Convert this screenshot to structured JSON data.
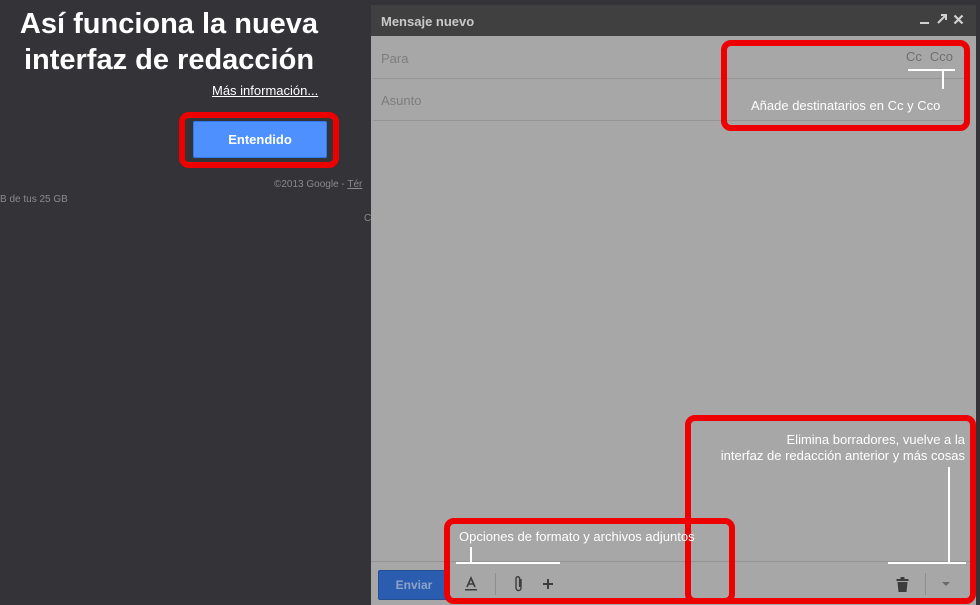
{
  "background": {
    "footer_text": "©2013 Google - ",
    "footer_link": "Tér",
    "storage_text": "B de tus 25 GB",
    "partial_char": "C"
  },
  "tour": {
    "title": "Así funciona la nueva interfaz de redacción",
    "more_info_link": "Más información...",
    "got_it_button": "Entendido"
  },
  "compose": {
    "window_title": "Mensaje nuevo",
    "header_icons": [
      "minimize-icon",
      "pop-out-icon",
      "close-icon"
    ],
    "to_label": "Para",
    "subject_label": "Asunto",
    "cc_link": "Cc",
    "bcc_link": "Cco",
    "send_button": "Enviar",
    "toolbar_icons": [
      "text-format-icon",
      "attachment-icon",
      "plus-icon",
      "trash-icon",
      "more-options-icon"
    ]
  },
  "annotations": {
    "cc_note": "Añade destinatarios en Cc y Cco",
    "discard_note_line1": "Elimina borradores, vuelve a la",
    "discard_note_line2": "interfaz de redacción anterior y más cosas",
    "format_note": "Opciones de formato y archivos adjuntos"
  },
  "colors": {
    "highlight": "#ee0000",
    "primary_button": "#4d90fe",
    "send_button": "#2a5db0",
    "overlay": "#343337"
  }
}
